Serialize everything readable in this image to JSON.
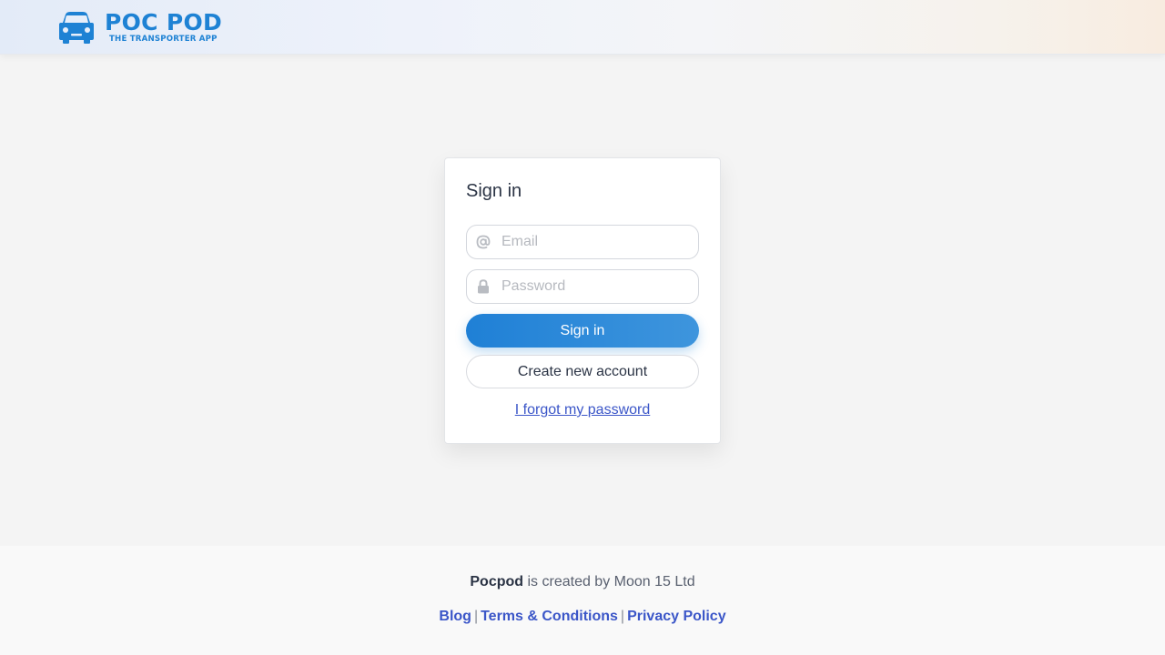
{
  "brand": {
    "name": "POC POD",
    "tagline": "THE TRANSPORTER APP",
    "logo_icon": "car-icon",
    "accent_color": "#1e82d4"
  },
  "signin": {
    "title": "Sign in",
    "email_placeholder": "Email",
    "email_value": "",
    "email_icon": "at-sign-icon",
    "password_placeholder": "Password",
    "password_value": "",
    "password_icon": "lock-icon",
    "submit_label": "Sign in",
    "create_account_label": "Create new account",
    "forgot_password_label": "I forgot my password",
    "primary_color": "#1f80d6",
    "link_color": "#3b56c8"
  },
  "footer": {
    "brand": "Pocpod",
    "credit_text": " is created by Moon 15 Ltd",
    "links": [
      "Blog",
      "Terms & Conditions",
      "Privacy Policy"
    ],
    "separator": "|"
  }
}
